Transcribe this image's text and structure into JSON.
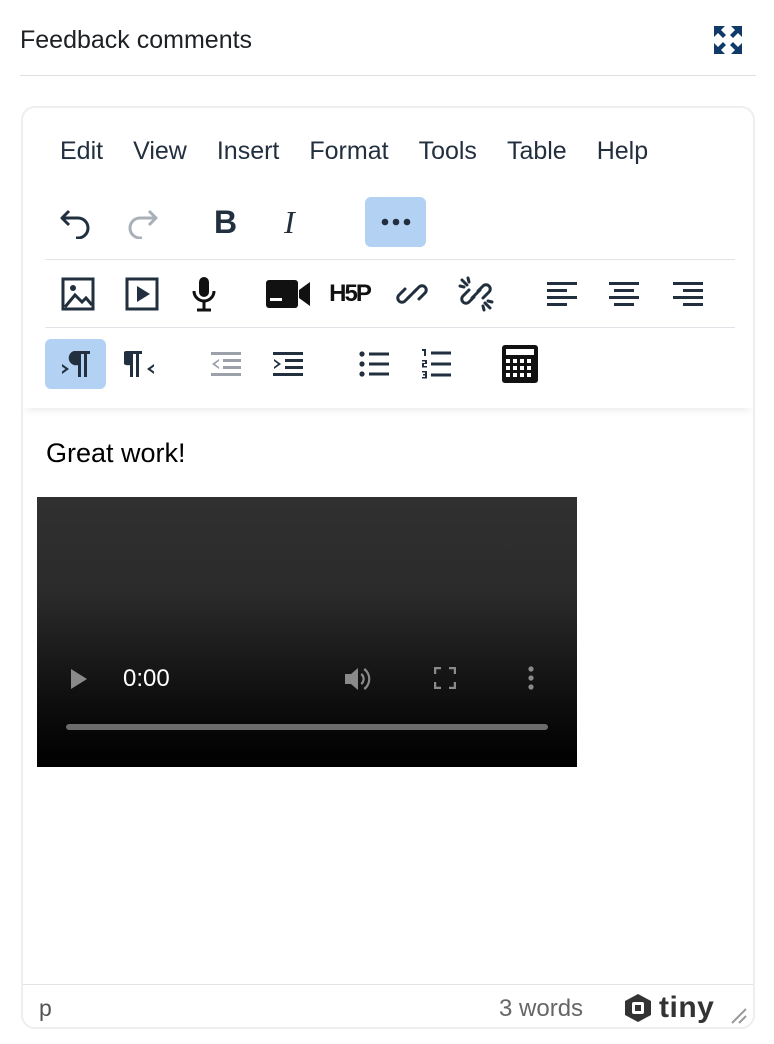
{
  "header": {
    "title": "Feedback comments",
    "expand_icon": "expand-arrows-icon"
  },
  "menubar": {
    "items": [
      {
        "label": "Edit"
      },
      {
        "label": "View"
      },
      {
        "label": "Insert"
      },
      {
        "label": "Format"
      },
      {
        "label": "Tools"
      },
      {
        "label": "Table"
      },
      {
        "label": "Help"
      }
    ]
  },
  "toolbar": {
    "row1": [
      "undo-icon",
      "redo-icon",
      "bold-icon",
      "italic-icon",
      "more-options-icon"
    ],
    "bold_label": "B",
    "italic_label": "I",
    "row2": [
      "image-icon",
      "media-icon",
      "microphone-icon",
      "video-camera-icon",
      "h5p-icon",
      "link-icon",
      "unlink-icon",
      "align-left-icon",
      "align-center-icon",
      "align-right-icon"
    ],
    "h5p_label": "H5P",
    "row3": [
      "ltr-direction-icon",
      "rtl-direction-icon",
      "outdent-icon",
      "indent-icon",
      "bullet-list-icon",
      "numbered-list-icon",
      "calculator-icon"
    ],
    "active": [
      "more-options-icon",
      "ltr-direction-icon"
    ],
    "accent_color": "#b3d1f2"
  },
  "content": {
    "paragraph": "Great work!",
    "video": {
      "time": "0:00",
      "progress": 0
    }
  },
  "statusbar": {
    "path": "p",
    "word_count": "3 words",
    "brand": "tiny"
  }
}
